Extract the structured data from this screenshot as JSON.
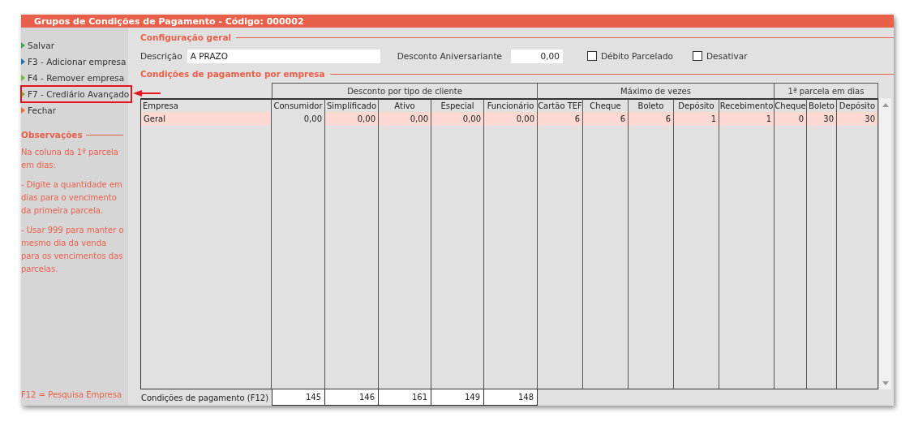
{
  "window": {
    "title": "Grupos de Condições de Pagamento - Código: 000002"
  },
  "sidebar": {
    "actions": [
      {
        "label": "Salvar",
        "color": "#3aa843",
        "highlighted": false
      },
      {
        "label": "F3 - Adicionar empresa",
        "color": "#2a6fb0",
        "highlighted": false
      },
      {
        "label": "F4 - Remover empresa",
        "color": "#6cb83a",
        "highlighted": false
      },
      {
        "label": "F7 - Crediário Avançado",
        "color": "#6cb83a",
        "highlighted": true
      },
      {
        "label": "Fechar",
        "color": "#f0702a",
        "highlighted": false
      }
    ],
    "notes_title": "Observações",
    "notes": [
      "Na coluna da 1º parcela em dias:",
      "- Digite a quantidade em dias para o vencimento da primeira parcela.",
      "- Usar 999 para manter o mesmo dia da venda para os vencimentos das parcelas."
    ],
    "shortcut": "F12 = Pesquisa Empresa"
  },
  "general": {
    "title": "Configuração geral",
    "description_label": "Descrição",
    "description_value": "A PRAZO",
    "discount_label": "Desconto Aniversariante",
    "discount_value": "0,00",
    "checkboxes": [
      {
        "label": "Débito Parcelado",
        "checked": false
      },
      {
        "label": "Desativar",
        "checked": false
      }
    ]
  },
  "table": {
    "title": "Condições de pagamento por empresa",
    "first_column": "Empresa",
    "column_groups": [
      {
        "label": "Desconto por tipo de cliente",
        "columns": [
          "Consumidor",
          "Simplificado",
          "Ativo",
          "Especial",
          "Funcionário"
        ]
      },
      {
        "label": "Máximo de vezes",
        "columns": [
          "Cartão TEF",
          "Cheque",
          "Boleto",
          "Depósito",
          "Recebimento"
        ]
      },
      {
        "label": "1ª parcela em dias",
        "columns": [
          "Cheque",
          "Boleto",
          "Depósito"
        ]
      }
    ],
    "rows": [
      {
        "selected": true,
        "cells": [
          "Geral",
          "0,00",
          "0,00",
          "0,00",
          "0,00",
          "0,00",
          "6",
          "6",
          "6",
          "1",
          "1",
          "0",
          "30",
          "30"
        ]
      }
    ],
    "footer": {
      "label": "Condições de pagamento (F12)",
      "values": [
        "145",
        "146",
        "161",
        "149",
        "148"
      ]
    }
  }
}
